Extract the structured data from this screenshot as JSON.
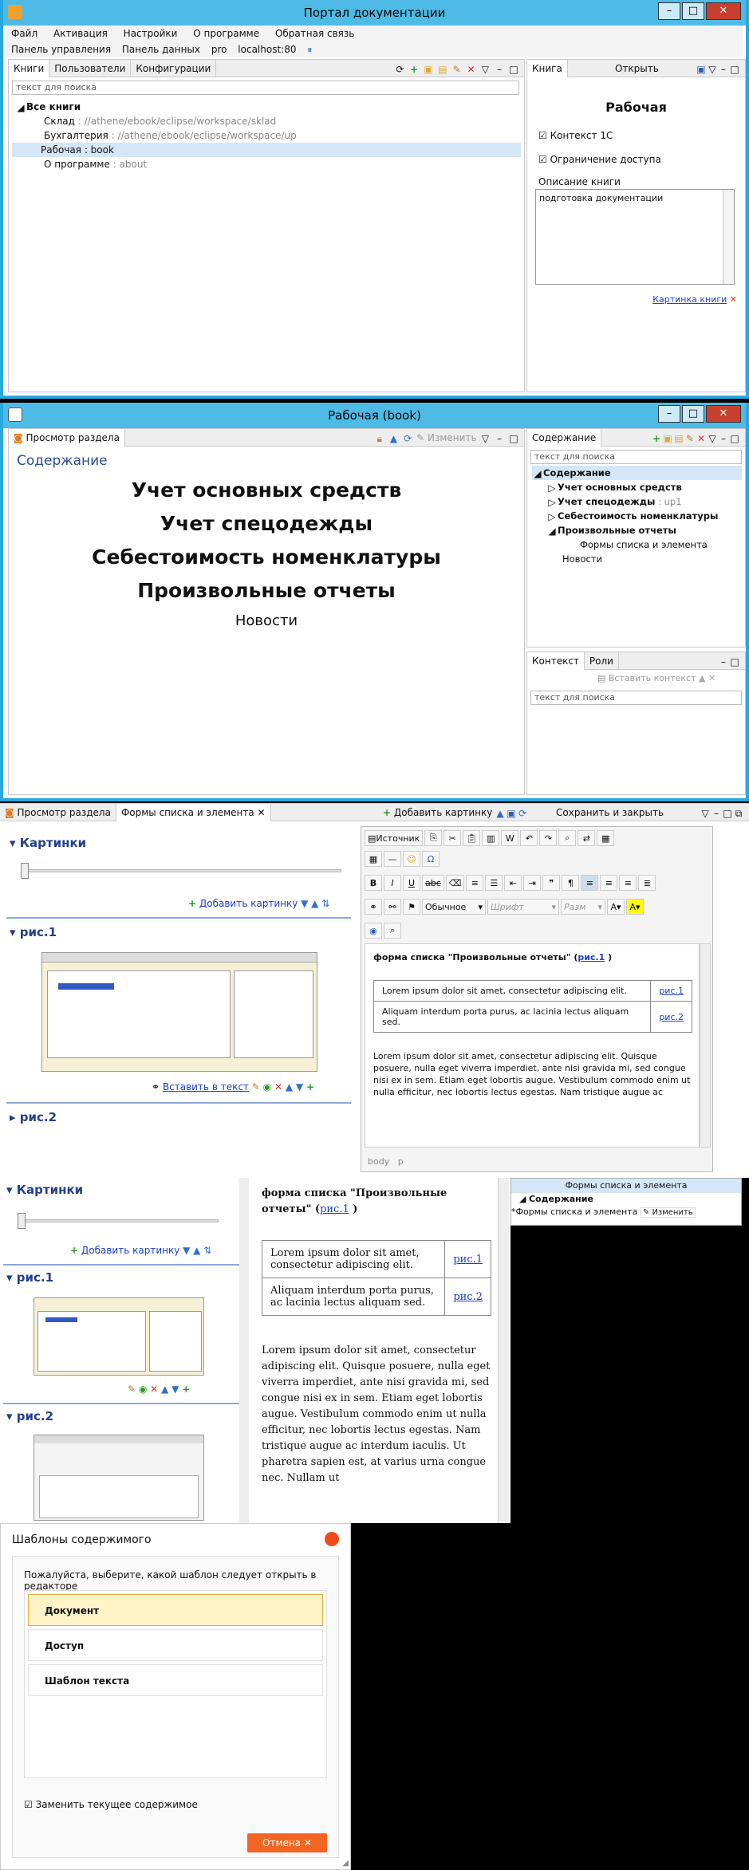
{
  "win1": {
    "title": "Портал документации",
    "menu": [
      "Файл",
      "Активация",
      "Настройки",
      "О программе",
      "Обратная связь"
    ],
    "toolbar": [
      "Панель управления",
      "Панель данных",
      "pro",
      "localhost:80"
    ],
    "left_tabs": [
      "Книги",
      "Пользователи",
      "Конфигурации"
    ],
    "search_placeholder": "текст для поиска",
    "tree_root": "Все книги",
    "tree": [
      {
        "name": "Склад",
        "path": " : //athene/ebook/eclipse/workspace/sklad"
      },
      {
        "name": "Бухгалтерия",
        "path": " : //athene/ebook/eclipse/workspace/up"
      },
      {
        "name": "Рабочая",
        "path": " : book"
      },
      {
        "name": "О программе",
        "path": " : about"
      }
    ],
    "right_tab": "Книга",
    "right_open": "Открыть",
    "book_title": "Рабочая",
    "chk1": "Контекст 1С",
    "chk2": "Ограничение доступа",
    "desc_label": "Описание книги",
    "desc_value": "подготовка документации",
    "book_image_link": "Картинка книги"
  },
  "win2": {
    "title": "Рабочая (book)",
    "tab": "Просмотр раздела",
    "change": "Изменить",
    "heading": "Содержание",
    "toc": [
      "Учет основных средств",
      "Учет спецодежды",
      "Себестоимость номенклатуры",
      "Произвольные отчеты"
    ],
    "news": "Новости",
    "right_tab": "Содержание",
    "search_placeholder": "текст для поиска",
    "tree_root": "Содержание",
    "tree": [
      {
        "name": "Учет основных средств",
        "extra": ""
      },
      {
        "name": "Учет спецодежды",
        "extra": " : up1"
      },
      {
        "name": "Себестоимость номенклатуры",
        "extra": ""
      },
      {
        "name": "Произвольные отчеты",
        "extra": ""
      }
    ],
    "tree_child": "Формы списка и элемента",
    "tree_news": "Новости",
    "ctx_tabs": [
      "Контекст",
      "Роли"
    ],
    "insert_ctx": "Вставить контекст",
    "ctx_search": "текст для поиска"
  },
  "win3": {
    "tabs": [
      "Просмотр раздела",
      "Формы списка и элемента"
    ],
    "add_image": "Добавить картинку",
    "save_close": "Сохранить и закрыть",
    "pictures": "Картинки",
    "pic_add": "Добавить картинку",
    "fig1": "рис.1",
    "fig2": "рис.2",
    "insert_text": "Вставить в текст",
    "source": "Источник",
    "format": "Обычное",
    "font": "Шрифт",
    "size": "Разм",
    "doc_heading": "форма списка \"Произвольные отчеты\"",
    "doc_ref": "рис.1",
    "row1": "Lorem ipsum dolor sit amet, consectetur adipiscing elit.",
    "row2": "Aliquam interdum porta purus, ac lacinia lectus aliquam sed.",
    "para": "Lorem ipsum dolor sit amet, consectetur adipiscing elit. Quisque posuere, nulla eget viverra imperdiet, ante nisi gravida mi, sed congue nisi ex in sem. Etiam eget lobortis augue. Vestibulum commodo enim ut nulla efficitur, nec lobortis lectus egestas. Nam tristique augue ac",
    "statusbar": "body   p"
  },
  "win4": {
    "pictures": "Картинки",
    "pic_add": "Добавить картинку",
    "fig1": "рис.1",
    "fig2": "рис.2",
    "doc_heading": "форма списка \"Произвольные отчеты\"",
    "doc_ref": "рис.1",
    "row1": "Lorem ipsum dolor sit amet, consectetur adipiscing elit.",
    "row2": "Aliquam interdum porta purus, ac lacinia lectus aliquam sed.",
    "para": "Lorem ipsum dolor sit amet, consectetur adipiscing elit. Quisque posuere, nulla eget viverra imperdiet, ante nisi gravida mi, sed congue nisi ex in sem. Etiam eget lobortis augue. Vestibulum commodo enim ut nulla efficitur, nec lobortis lectus egestas. Nam tristique augue ac interdum iaculis. Ut pharetra sapien est, at varius urna congue nec. Nullam ut",
    "popup_title": "Формы списка и элемента",
    "popup_root": "Содержание",
    "popup_item": "*Формы списка и элемента",
    "popup_change": "Изменить"
  },
  "dialog": {
    "title": "Шаблоны содержимого",
    "prompt": "Пожалуйста, выберите, какой шаблон следует открыть в редакторе",
    "items": [
      "Документ",
      "Доступ",
      "Шаблон текста"
    ],
    "replace": "Заменить текущее содержимое",
    "cancel": "Отмена"
  },
  "colors": {
    "accent": "#29a8e0",
    "link": "#1a3ec9",
    "section": "#243f8a",
    "selected": "#d5e6f7",
    "cancel": "#f26522"
  }
}
